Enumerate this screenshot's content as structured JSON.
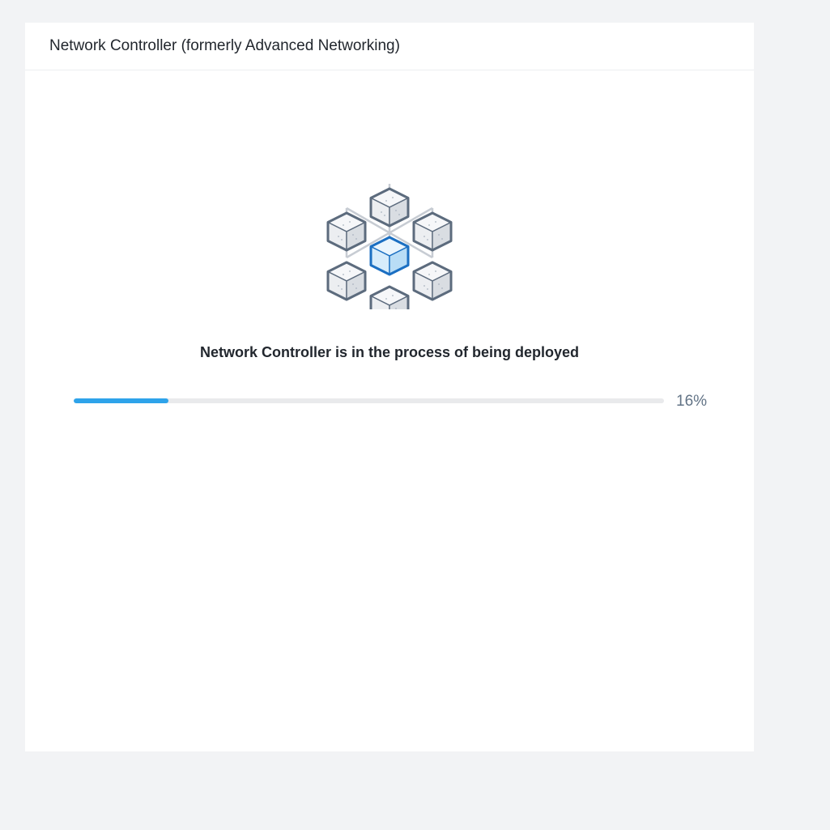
{
  "panel": {
    "title": "Network Controller (formerly Advanced Networking)"
  },
  "illustration": {
    "icon": "network-cluster-icon"
  },
  "status": {
    "message": "Network Controller is in the process of being deployed"
  },
  "progress": {
    "value": 0.16,
    "label": "16%"
  },
  "colors": {
    "page_background": "#f2f3f5",
    "panel_background": "#ffffff",
    "accent": "#2ea3ea",
    "center_node": "#1b6fc2",
    "node_stroke": "#5c6b7d",
    "track": "#e9eaec"
  }
}
